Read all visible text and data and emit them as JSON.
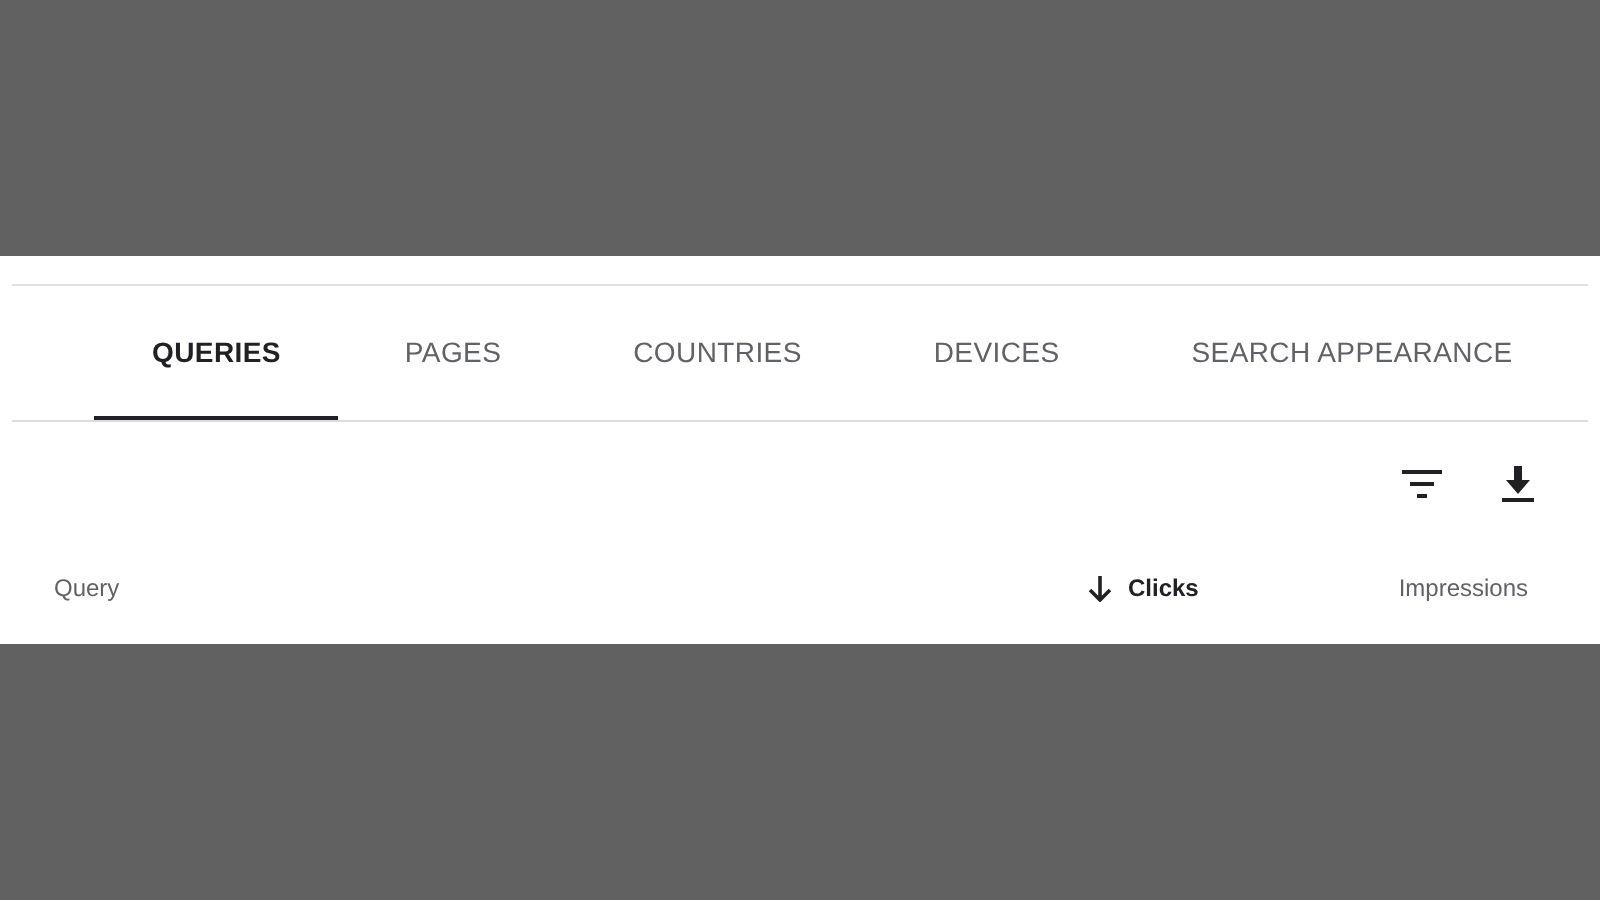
{
  "tabs": [
    {
      "label": "QUERIES",
      "selected": true
    },
    {
      "label": "PAGES",
      "selected": false
    },
    {
      "label": "COUNTRIES",
      "selected": false
    },
    {
      "label": "DEVICES",
      "selected": false
    },
    {
      "label": "SEARCH APPEARANCE",
      "selected": false
    }
  ],
  "table": {
    "columns": [
      {
        "label": "Query",
        "sorted": false
      },
      {
        "label": "Clicks",
        "sorted": true
      },
      {
        "label": "Impressions",
        "sorted": false
      }
    ]
  }
}
